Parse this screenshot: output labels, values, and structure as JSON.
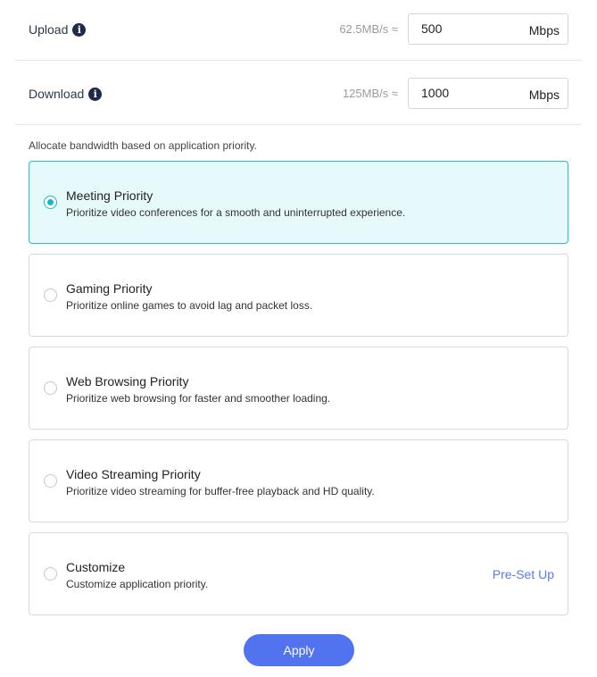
{
  "bandwidth": {
    "upload": {
      "label": "Upload",
      "approx": "62.5MB/s ≈",
      "value": "500",
      "unit": "Mbps"
    },
    "download": {
      "label": "Download",
      "approx": "125MB/s ≈",
      "value": "1000",
      "unit": "Mbps"
    },
    "info_icon": "info-icon"
  },
  "allocate_note": "Allocate bandwidth based on application priority.",
  "options": [
    {
      "title": "Meeting Priority",
      "description": "Prioritize video conferences for a smooth and uninterrupted experience.",
      "selected": true
    },
    {
      "title": "Gaming Priority",
      "description": "Prioritize online games to avoid lag and packet loss.",
      "selected": false
    },
    {
      "title": "Web Browsing Priority",
      "description": "Prioritize web browsing for faster and smoother loading.",
      "selected": false
    },
    {
      "title": "Video Streaming Priority",
      "description": "Prioritize video streaming for buffer-free playback and HD quality.",
      "selected": false
    },
    {
      "title": "Customize",
      "description": "Customize application priority.",
      "selected": false,
      "link_label": "Pre-Set Up"
    }
  ],
  "apply_label": "Apply",
  "colors": {
    "accent": "#18b9c6",
    "selected_bg": "#e6f9fb",
    "link": "#5b7be8",
    "button": "#5273f0"
  }
}
